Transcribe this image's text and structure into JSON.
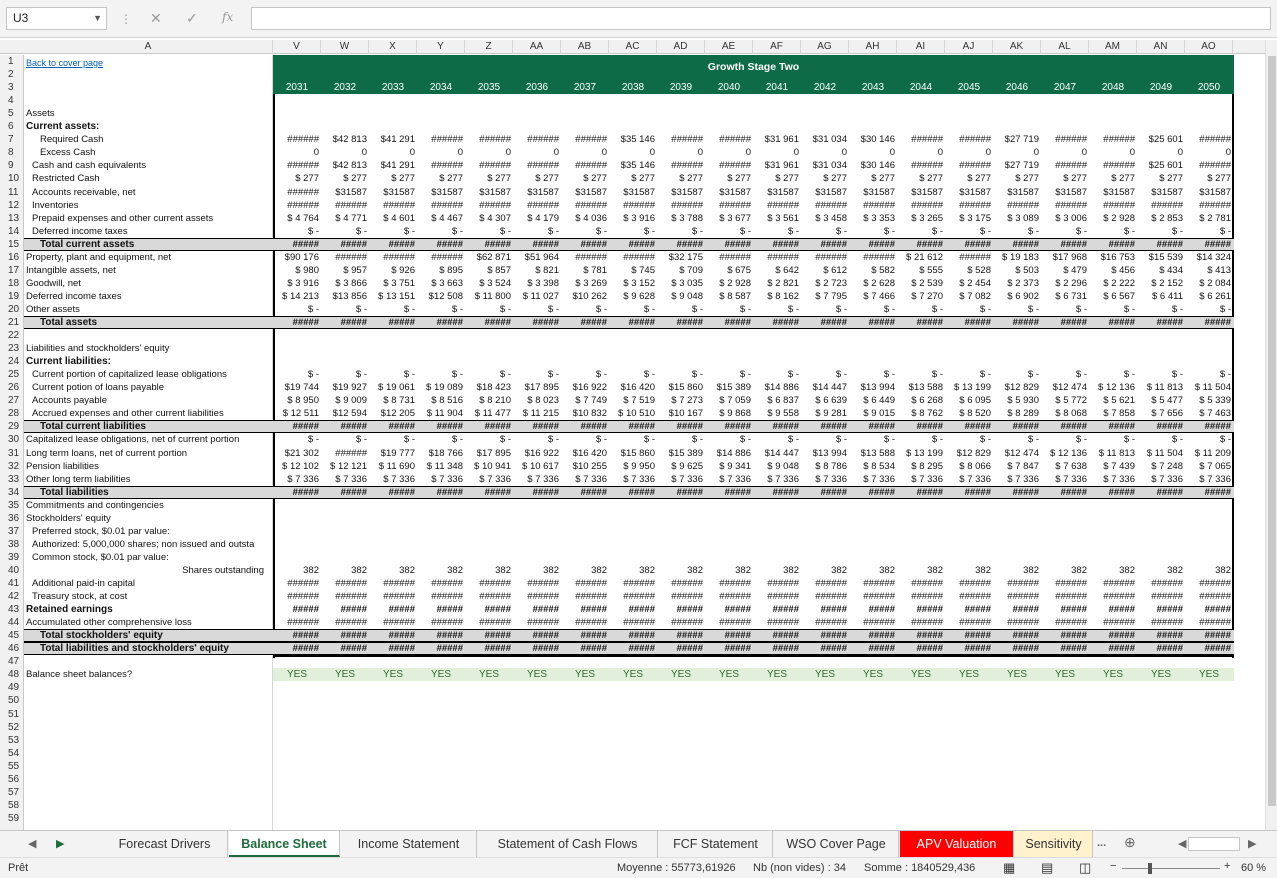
{
  "app": {
    "name_box": "U3",
    "formula": ""
  },
  "columns": [
    "A",
    "V",
    "W",
    "X",
    "Y",
    "Z",
    "AA",
    "AB",
    "AC",
    "AD",
    "AE",
    "AF",
    "AG",
    "AH",
    "AI",
    "AJ",
    "AK",
    "AL",
    "AM",
    "AN",
    "AO"
  ],
  "header": {
    "link": "Back to cover page",
    "band_title": "Growth Stage Two",
    "years": [
      "2031",
      "2032",
      "2033",
      "2034",
      "2035",
      "2036",
      "2037",
      "2038",
      "2039",
      "2040",
      "2041",
      "2042",
      "2043",
      "2044",
      "2045",
      "2046",
      "2047",
      "2048",
      "2049",
      "2050"
    ]
  },
  "rows": [
    {
      "n": 1,
      "label": ""
    },
    {
      "n": 2,
      "label": ""
    },
    {
      "n": 3,
      "label": ""
    },
    {
      "n": 4,
      "label": ""
    },
    {
      "n": 5,
      "label": "Assets",
      "style": ""
    },
    {
      "n": 6,
      "label": "Current assets:",
      "style": "b"
    },
    {
      "n": 7,
      "label": "Required Cash",
      "style": "i2",
      "vals": [
        "######",
        "$42 813",
        "$41 291",
        "######",
        "######",
        "######",
        "######",
        "$35 146",
        "######",
        "######",
        "$31 961",
        "$31 034",
        "$30 146",
        "######",
        "######",
        "$27 719",
        "######",
        "######",
        "$25 601",
        "######"
      ]
    },
    {
      "n": 8,
      "label": "Excess Cash",
      "style": "i2",
      "vals": [
        "0",
        "0",
        "0",
        "0",
        "0",
        "0",
        "0",
        "0",
        "0",
        "0",
        "0",
        "0",
        "0",
        "0",
        "0",
        "0",
        "0",
        "0",
        "0",
        "0"
      ]
    },
    {
      "n": 9,
      "label": "Cash and cash equivalents",
      "style": "i1",
      "vals": [
        "######",
        "$42 813",
        "$41 291",
        "######",
        "######",
        "######",
        "######",
        "$35 146",
        "######",
        "######",
        "$31 961",
        "$31 034",
        "$30 146",
        "######",
        "######",
        "$27 719",
        "######",
        "######",
        "$25 601",
        "######"
      ]
    },
    {
      "n": 10,
      "label": "Restricted Cash",
      "style": "i1",
      "vals": [
        "$ 277",
        "$ 277",
        "$ 277",
        "$ 277",
        "$ 277",
        "$ 277",
        "$ 277",
        "$ 277",
        "$ 277",
        "$ 277",
        "$ 277",
        "$ 277",
        "$ 277",
        "$ 277",
        "$ 277",
        "$ 277",
        "$ 277",
        "$ 277",
        "$ 277",
        "$ 277"
      ]
    },
    {
      "n": 11,
      "label": "Accounts receivable, net",
      "style": "i1",
      "vals": [
        "######",
        "$31587",
        "$31587",
        "$31587",
        "$31587",
        "$31587",
        "$31587",
        "$31587",
        "$31587",
        "$31587",
        "$31587",
        "$31587",
        "$31587",
        "$31587",
        "$31587",
        "$31587",
        "$31587",
        "$31587",
        "$31587",
        "$31587"
      ]
    },
    {
      "n": 12,
      "label": "Inventories",
      "style": "i1",
      "vals": [
        "######",
        "######",
        "######",
        "######",
        "######",
        "######",
        "######",
        "######",
        "######",
        "######",
        "######",
        "######",
        "######",
        "######",
        "######",
        "######",
        "######",
        "######",
        "######",
        "######"
      ]
    },
    {
      "n": 13,
      "label": "Prepaid expenses and other current assets",
      "style": "i1",
      "vals": [
        "$ 4 764",
        "$ 4 771",
        "$ 4 601",
        "$ 4 467",
        "$ 4 307",
        "$ 4 179",
        "$ 4 036",
        "$ 3 916",
        "$ 3 788",
        "$ 3 677",
        "$ 3 561",
        "$ 3 458",
        "$ 3 353",
        "$ 3 265",
        "$ 3 175",
        "$ 3 089",
        "$ 3 006",
        "$ 2 928",
        "$ 2 853",
        "$ 2 781"
      ]
    },
    {
      "n": 14,
      "label": "Deferred income taxes",
      "style": "i1",
      "vals": [
        "$ -",
        "$ -",
        "$ -",
        "$ -",
        "$ -",
        "$ -",
        "$ -",
        "$ -",
        "$ -",
        "$ -",
        "$ -",
        "$ -",
        "$ -",
        "$ -",
        "$ -",
        "$ -",
        "$ -",
        "$ -",
        "$ -",
        "$ -"
      ]
    },
    {
      "n": 15,
      "label": "Total current assets",
      "style": "tot",
      "vals": [
        "#####",
        "#####",
        "#####",
        "#####",
        "#####",
        "#####",
        "#####",
        "#####",
        "#####",
        "#####",
        "#####",
        "#####",
        "#####",
        "#####",
        "#####",
        "#####",
        "#####",
        "#####",
        "#####",
        "#####"
      ]
    },
    {
      "n": 16,
      "label": "Property, plant and equipment, net",
      "style": "",
      "vals": [
        "$90 176",
        "######",
        "######",
        "######",
        "$62 871",
        "$51 964",
        "######",
        "######",
        "$32 175",
        "######",
        "######",
        "######",
        "######",
        "$ 21 612",
        "######",
        "$ 19 183",
        "$17 968",
        "$16 753",
        "$15 539",
        "$14 324"
      ]
    },
    {
      "n": 17,
      "label": "Intangible assets, net",
      "style": "",
      "vals": [
        "$ 980",
        "$ 957",
        "$ 926",
        "$ 895",
        "$ 857",
        "$ 821",
        "$ 781",
        "$ 745",
        "$ 709",
        "$ 675",
        "$ 642",
        "$ 612",
        "$ 582",
        "$ 555",
        "$ 528",
        "$ 503",
        "$ 479",
        "$ 456",
        "$ 434",
        "$ 413"
      ]
    },
    {
      "n": 18,
      "label": "Goodwill, net",
      "style": "",
      "vals": [
        "$ 3 916",
        "$ 3 866",
        "$ 3 751",
        "$ 3 663",
        "$ 3 524",
        "$ 3 398",
        "$ 3 269",
        "$ 3 152",
        "$ 3 035",
        "$ 2 928",
        "$ 2 821",
        "$ 2 723",
        "$ 2 628",
        "$ 2 539",
        "$ 2 454",
        "$ 2 373",
        "$ 2 296",
        "$ 2 222",
        "$ 2 152",
        "$ 2 084"
      ]
    },
    {
      "n": 19,
      "label": "Deferred income taxes",
      "style": "",
      "vals": [
        "$ 14 213",
        "$13 856",
        "$ 13 151",
        "$12 508",
        "$ 11 800",
        "$ 11 027",
        "$10 262",
        "$ 9 628",
        "$ 9 048",
        "$ 8 587",
        "$ 8 162",
        "$ 7 795",
        "$ 7 466",
        "$ 7 270",
        "$ 7 082",
        "$ 6 902",
        "$ 6 731",
        "$ 6 567",
        "$ 6 411",
        "$ 6 261"
      ]
    },
    {
      "n": 20,
      "label": "Other assets",
      "style": "",
      "vals": [
        "$ -",
        "$ -",
        "$ -",
        "$ -",
        "$ -",
        "$ -",
        "$ -",
        "$ -",
        "$ -",
        "$ -",
        "$ -",
        "$ -",
        "$ -",
        "$ -",
        "$ -",
        "$ -",
        "$ -",
        "$ -",
        "$ -",
        "$ -"
      ]
    },
    {
      "n": 21,
      "label": "Total assets",
      "style": "tot",
      "vals": [
        "#####",
        "#####",
        "#####",
        "#####",
        "#####",
        "#####",
        "#####",
        "#####",
        "#####",
        "#####",
        "#####",
        "#####",
        "#####",
        "#####",
        "#####",
        "#####",
        "#####",
        "#####",
        "#####",
        "#####"
      ]
    },
    {
      "n": 22,
      "label": ""
    },
    {
      "n": 23,
      "label": "Liabilities and stockholders' equity",
      "style": ""
    },
    {
      "n": 24,
      "label": "Current liabilities:",
      "style": "b"
    },
    {
      "n": 25,
      "label": "Current portion of capitalized lease obligations",
      "style": "i1",
      "vals": [
        "$ -",
        "$ -",
        "$ -",
        "$ -",
        "$ -",
        "$ -",
        "$ -",
        "$ -",
        "$ -",
        "$ -",
        "$ -",
        "$ -",
        "$ -",
        "$ -",
        "$ -",
        "$ -",
        "$ -",
        "$ -",
        "$ -",
        "$ -"
      ]
    },
    {
      "n": 26,
      "label": "Current potion of loans payable",
      "style": "i1",
      "vals": [
        "$19 744",
        "$19 927",
        "$ 19 061",
        "$ 19 089",
        "$18 423",
        "$17 895",
        "$16 922",
        "$16 420",
        "$15 860",
        "$15 389",
        "$14 886",
        "$14 447",
        "$13 994",
        "$13 588",
        "$ 13 199",
        "$12 829",
        "$12 474",
        "$ 12 136",
        "$ 11 813",
        "$ 11 504"
      ]
    },
    {
      "n": 27,
      "label": "Accounts payable",
      "style": "i1",
      "vals": [
        "$ 8 950",
        "$ 9 009",
        "$ 8 731",
        "$ 8 516",
        "$ 8 210",
        "$ 8 023",
        "$ 7 749",
        "$ 7 519",
        "$ 7 273",
        "$ 7 059",
        "$ 6 837",
        "$ 6 639",
        "$ 6 449",
        "$ 6 268",
        "$ 6 095",
        "$ 5 930",
        "$ 5 772",
        "$ 5 621",
        "$ 5 477",
        "$ 5 339"
      ]
    },
    {
      "n": 28,
      "label": "Accrued expenses and other current liabilities",
      "style": "i1",
      "vals": [
        "$ 12 511",
        "$12 594",
        "$12 205",
        "$ 11 904",
        "$ 11 477",
        "$ 11 215",
        "$10 832",
        "$ 10 510",
        "$10 167",
        "$ 9 868",
        "$ 9 558",
        "$ 9 281",
        "$ 9 015",
        "$ 8 762",
        "$ 8 520",
        "$ 8 289",
        "$ 8 068",
        "$ 7 858",
        "$ 7 656",
        "$ 7 463"
      ]
    },
    {
      "n": 29,
      "label": "Total current liabilities",
      "style": "tot",
      "vals": [
        "#####",
        "#####",
        "#####",
        "#####",
        "#####",
        "#####",
        "#####",
        "#####",
        "#####",
        "#####",
        "#####",
        "#####",
        "#####",
        "#####",
        "#####",
        "#####",
        "#####",
        "#####",
        "#####",
        "#####"
      ]
    },
    {
      "n": 30,
      "label": "Capitalized lease obligations, net of current portion",
      "style": "",
      "vals": [
        "$ -",
        "$ -",
        "$ -",
        "$ -",
        "$ -",
        "$ -",
        "$ -",
        "$ -",
        "$ -",
        "$ -",
        "$ -",
        "$ -",
        "$ -",
        "$ -",
        "$ -",
        "$ -",
        "$ -",
        "$ -",
        "$ -",
        "$ -"
      ]
    },
    {
      "n": 31,
      "label": "Long term loans, net of current portion",
      "style": "",
      "vals": [
        "$21 302",
        "######",
        "$19 777",
        "$18 766",
        "$17 895",
        "$16 922",
        "$16 420",
        "$15 860",
        "$15 389",
        "$14 886",
        "$14 447",
        "$13 994",
        "$13 588",
        "$ 13 199",
        "$12 829",
        "$12 474",
        "$ 12 136",
        "$ 11 813",
        "$ 11 504",
        "$ 11 209"
      ]
    },
    {
      "n": 32,
      "label": "Pension liabilities",
      "style": "",
      "vals": [
        "$ 12 102",
        "$ 12 121",
        "$ 11 690",
        "$ 11 348",
        "$ 10 941",
        "$ 10 617",
        "$10 255",
        "$ 9 950",
        "$ 9 625",
        "$ 9 341",
        "$ 9 048",
        "$ 8 786",
        "$ 8 534",
        "$ 8 295",
        "$ 8 066",
        "$ 7 847",
        "$ 7 638",
        "$ 7 439",
        "$ 7 248",
        "$ 7 065"
      ]
    },
    {
      "n": 33,
      "label": "Other long term liabilities",
      "style": "",
      "vals": [
        "$ 7 336",
        "$ 7 336",
        "$ 7 336",
        "$ 7 336",
        "$ 7 336",
        "$ 7 336",
        "$ 7 336",
        "$ 7 336",
        "$ 7 336",
        "$ 7 336",
        "$ 7 336",
        "$ 7 336",
        "$ 7 336",
        "$ 7 336",
        "$ 7 336",
        "$ 7 336",
        "$ 7 336",
        "$ 7 336",
        "$ 7 336",
        "$ 7 336"
      ]
    },
    {
      "n": 34,
      "label": "Total liabilities",
      "style": "tot",
      "vals": [
        "#####",
        "#####",
        "#####",
        "#####",
        "#####",
        "#####",
        "#####",
        "#####",
        "#####",
        "#####",
        "#####",
        "#####",
        "#####",
        "#####",
        "#####",
        "#####",
        "#####",
        "#####",
        "#####",
        "#####"
      ]
    },
    {
      "n": 35,
      "label": "Commitments and contingencies",
      "style": ""
    },
    {
      "n": 36,
      "label": "Stockholders' equity",
      "style": ""
    },
    {
      "n": 37,
      "label": "Preferred stock, $0.01 par value:",
      "style": "i1"
    },
    {
      "n": 38,
      "label": "Authorized: 5,000,000 shares; non issued and outsta",
      "style": "i1"
    },
    {
      "n": 39,
      "label": "Common stock, $0.01 par value:",
      "style": "i1"
    },
    {
      "n": 40,
      "label": "Shares outstanding",
      "style": "right",
      "vals": [
        "382",
        "382",
        "382",
        "382",
        "382",
        "382",
        "382",
        "382",
        "382",
        "382",
        "382",
        "382",
        "382",
        "382",
        "382",
        "382",
        "382",
        "382",
        "382",
        "382"
      ]
    },
    {
      "n": 41,
      "label": "Additional paid-in capital",
      "style": "i1",
      "vals": [
        "######",
        "######",
        "######",
        "######",
        "######",
        "######",
        "######",
        "######",
        "######",
        "######",
        "######",
        "######",
        "######",
        "######",
        "######",
        "######",
        "######",
        "######",
        "######",
        "######"
      ]
    },
    {
      "n": 42,
      "label": "Treasury stock, at cost",
      "style": "i1",
      "vals": [
        "######",
        "######",
        "######",
        "######",
        "######",
        "######",
        "######",
        "######",
        "######",
        "######",
        "######",
        "######",
        "######",
        "######",
        "######",
        "######",
        "######",
        "######",
        "######",
        "######"
      ]
    },
    {
      "n": 43,
      "label": "Retained earnings",
      "style": "b",
      "vals": [
        "#####",
        "#####",
        "#####",
        "#####",
        "#####",
        "#####",
        "#####",
        "#####",
        "#####",
        "#####",
        "#####",
        "#####",
        "#####",
        "#####",
        "#####",
        "#####",
        "#####",
        "#####",
        "#####",
        "#####"
      ]
    },
    {
      "n": 44,
      "label": "Accumulated other comprehensive loss",
      "style": "",
      "vals": [
        "######",
        "######",
        "######",
        "######",
        "######",
        "######",
        "######",
        "######",
        "######",
        "######",
        "######",
        "######",
        "######",
        "######",
        "######",
        "######",
        "######",
        "######",
        "######",
        "######"
      ]
    },
    {
      "n": 45,
      "label": "Total stockholders' equity",
      "style": "tot",
      "vals": [
        "#####",
        "#####",
        "#####",
        "#####",
        "#####",
        "#####",
        "#####",
        "#####",
        "#####",
        "#####",
        "#####",
        "#####",
        "#####",
        "#####",
        "#####",
        "#####",
        "#####",
        "#####",
        "#####",
        "#####"
      ]
    },
    {
      "n": 46,
      "label": "Total liabilities and stockholders' equity",
      "style": "tot",
      "vals": [
        "#####",
        "#####",
        "#####",
        "#####",
        "#####",
        "#####",
        "#####",
        "#####",
        "#####",
        "#####",
        "#####",
        "#####",
        "#####",
        "#####",
        "#####",
        "#####",
        "#####",
        "#####",
        "#####",
        "#####"
      ]
    },
    {
      "n": 47,
      "label": ""
    },
    {
      "n": 48,
      "label": "Balance sheet balances?",
      "style": "",
      "yes": [
        "YES",
        "YES",
        "YES",
        "YES",
        "YES",
        "YES",
        "YES",
        "YES",
        "YES",
        "YES",
        "YES",
        "YES",
        "YES",
        "YES",
        "YES",
        "YES",
        "YES",
        "YES",
        "YES",
        "YES"
      ]
    },
    {
      "n": 49,
      "label": ""
    },
    {
      "n": 50,
      "label": ""
    },
    {
      "n": 51,
      "label": ""
    },
    {
      "n": 52,
      "label": ""
    },
    {
      "n": 53,
      "label": ""
    },
    {
      "n": 54,
      "label": ""
    },
    {
      "n": 55,
      "label": ""
    },
    {
      "n": 56,
      "label": ""
    },
    {
      "n": 57,
      "label": ""
    },
    {
      "n": 58,
      "label": ""
    },
    {
      "n": 59,
      "label": ""
    }
  ],
  "tabs": [
    {
      "label": "Forecast Drivers",
      "state": ""
    },
    {
      "label": "Balance Sheet",
      "state": "active"
    },
    {
      "label": "Income Statement",
      "state": ""
    },
    {
      "label": "Statement of Cash Flows",
      "state": ""
    },
    {
      "label": "FCF Statement",
      "state": ""
    },
    {
      "label": "WSO Cover Page",
      "state": ""
    },
    {
      "label": "APV Valuation",
      "state": "red"
    },
    {
      "label": "Sensitivity",
      "state": "yellow"
    }
  ],
  "tabs_more": "...",
  "status": {
    "ready": "Prêt",
    "average": "Moyenne : 55773,61926",
    "count": "Nb (non vides) : 34",
    "sum": "Somme : 1840529,436",
    "zoom": "60 %"
  },
  "colors": {
    "header_band": "#0d6b48",
    "active_tab": "#1e6b3a",
    "red_tab": "#ff0000",
    "yellow_tab": "#fff2cc",
    "yes_fill": "#e2efda"
  }
}
